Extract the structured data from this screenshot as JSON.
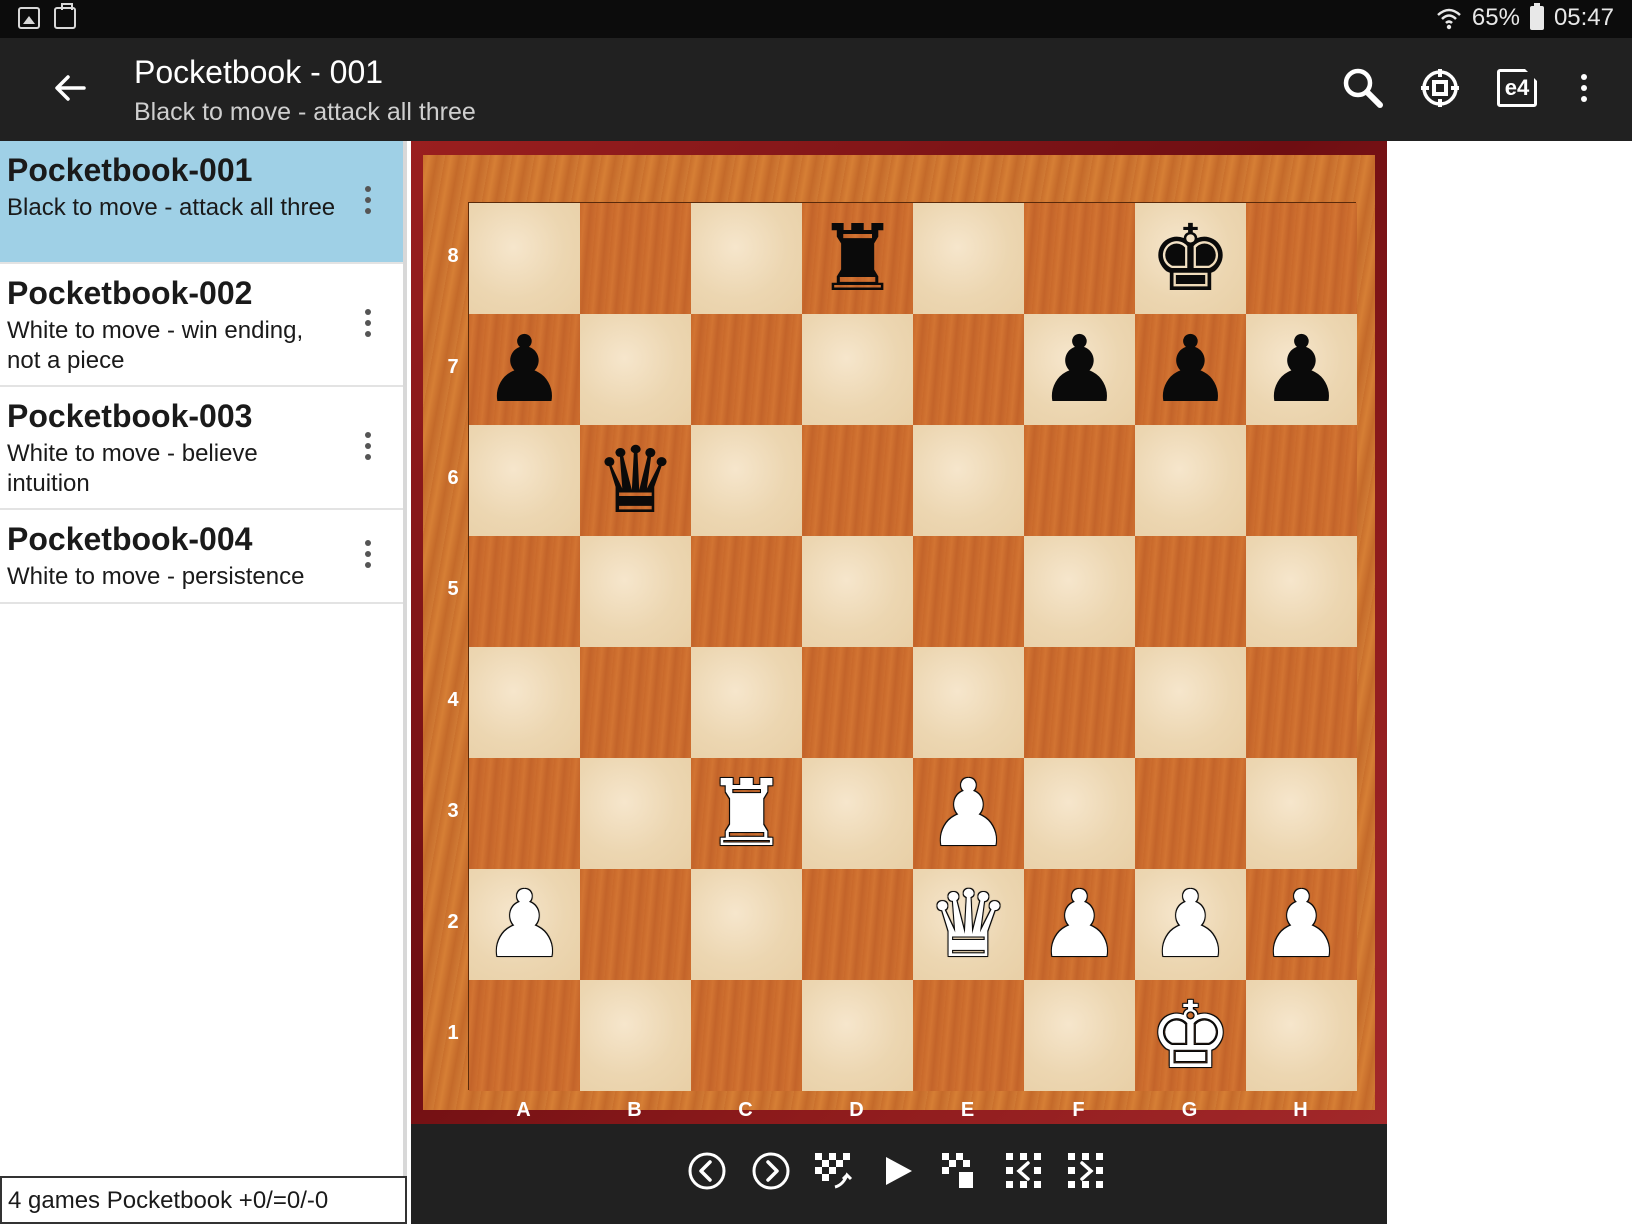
{
  "status": {
    "battery": "65%",
    "time": "05:47"
  },
  "appbar": {
    "title": "Pocketbook - 001",
    "subtitle": "Black to move - attack all three",
    "actions": [
      "search-icon",
      "target-icon",
      "e4-icon",
      "overflow-icon"
    ],
    "e4_label": "e4"
  },
  "games": [
    {
      "title": "Pocketbook-001",
      "subtitle": "Black to move - attack all three",
      "selected": true
    },
    {
      "title": "Pocketbook-002",
      "subtitle": "White to move - win ending, not a piece",
      "selected": false
    },
    {
      "title": "Pocketbook-003",
      "subtitle": "White to move - believe intuition",
      "selected": false
    },
    {
      "title": "Pocketbook-004",
      "subtitle": "White to move - persistence",
      "selected": false
    }
  ],
  "footer": {
    "summary": "4 games Pocketbook +0/=0/-0"
  },
  "board": {
    "files": [
      "A",
      "B",
      "C",
      "D",
      "E",
      "F",
      "G",
      "H"
    ],
    "ranks": [
      "8",
      "7",
      "6",
      "5",
      "4",
      "3",
      "2",
      "1"
    ],
    "pieces": [
      {
        "square": "d8",
        "piece": "rook",
        "color": "black"
      },
      {
        "square": "g8",
        "piece": "king",
        "color": "black"
      },
      {
        "square": "a7",
        "piece": "pawn",
        "color": "black"
      },
      {
        "square": "f7",
        "piece": "pawn",
        "color": "black"
      },
      {
        "square": "g7",
        "piece": "pawn",
        "color": "black"
      },
      {
        "square": "h7",
        "piece": "pawn",
        "color": "black"
      },
      {
        "square": "b6",
        "piece": "queen",
        "color": "black"
      },
      {
        "square": "c3",
        "piece": "rook",
        "color": "white"
      },
      {
        "square": "e3",
        "piece": "pawn",
        "color": "white"
      },
      {
        "square": "a2",
        "piece": "pawn",
        "color": "white"
      },
      {
        "square": "e2",
        "piece": "queen",
        "color": "white"
      },
      {
        "square": "f2",
        "piece": "pawn",
        "color": "white"
      },
      {
        "square": "g2",
        "piece": "pawn",
        "color": "white"
      },
      {
        "square": "h2",
        "piece": "pawn",
        "color": "white"
      },
      {
        "square": "g1",
        "piece": "king",
        "color": "white"
      }
    ]
  },
  "navbar": [
    "previous-move-icon",
    "next-move-icon",
    "board-edit-icon",
    "play-icon",
    "board-paste-icon",
    "previous-variation-icon",
    "next-variation-icon"
  ]
}
